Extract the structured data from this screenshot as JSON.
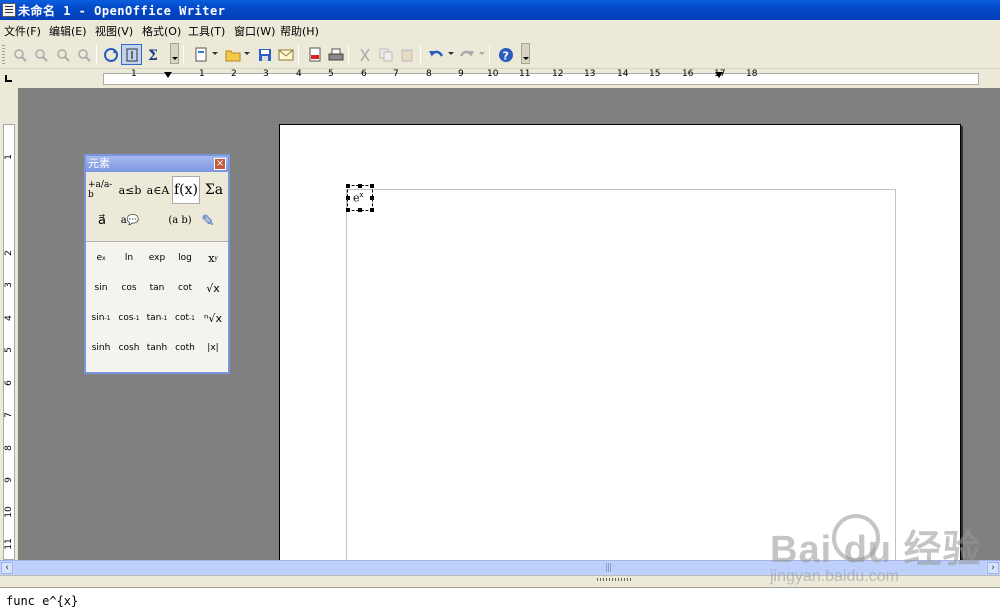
{
  "window": {
    "title": "未命名 1 - OpenOffice Writer"
  },
  "menu": [
    {
      "label": "文件(F)"
    },
    {
      "label": "编辑(E)"
    },
    {
      "label": "视图(V)"
    },
    {
      "label": "格式(O)"
    },
    {
      "label": "工具(T)"
    },
    {
      "label": "窗口(W)"
    },
    {
      "label": "帮助(H)"
    }
  ],
  "ruler": {
    "h_ticks": [
      "1",
      "2",
      "3",
      "4",
      "5",
      "6",
      "7",
      "8",
      "9",
      "10",
      "11",
      "12",
      "13",
      "14",
      "15",
      "16",
      "17",
      "18"
    ],
    "v_ticks": [
      "1",
      "1",
      "2",
      "3",
      "4",
      "5",
      "6",
      "7",
      "8",
      "9",
      "10",
      "11"
    ]
  },
  "elements_panel": {
    "title": "元素",
    "close_glyph": "×",
    "categories": [
      {
        "label": "+a/a-b"
      },
      {
        "label": "a≤b"
      },
      {
        "label": "a∈A"
      },
      {
        "label": "f(x)"
      },
      {
        "label": "Σa"
      },
      {
        "label": "a⃗"
      },
      {
        "label": "a💬"
      },
      {
        "label": "(a b)"
      },
      {
        "label": "✎"
      }
    ],
    "functions": [
      {
        "label": "e",
        "sup": "x"
      },
      {
        "label": "ln",
        "sup": ""
      },
      {
        "label": "exp",
        "sup": ""
      },
      {
        "label": "log",
        "sup": ""
      },
      {
        "label": "x",
        "sup": "y"
      },
      {
        "label": "sin",
        "sup": ""
      },
      {
        "label": "cos",
        "sup": ""
      },
      {
        "label": "tan",
        "sup": ""
      },
      {
        "label": "cot",
        "sup": ""
      },
      {
        "label": "√x",
        "sup": ""
      },
      {
        "label": "sin",
        "sup": "-1"
      },
      {
        "label": "cos",
        "sup": "-1"
      },
      {
        "label": "tan",
        "sup": "-1"
      },
      {
        "label": "cot",
        "sup": "-1"
      },
      {
        "label": "ⁿ√x",
        "sup": ""
      },
      {
        "label": "sinh",
        "sup": ""
      },
      {
        "label": "cosh",
        "sup": ""
      },
      {
        "label": "tanh",
        "sup": ""
      },
      {
        "label": "coth",
        "sup": ""
      },
      {
        "label": "|x|",
        "sup": ""
      }
    ]
  },
  "document": {
    "formula_base": "e",
    "formula_sup": "x"
  },
  "command": {
    "text": "func e^{x}"
  },
  "watermark": {
    "brand": "Bai du 经验",
    "url": "jingyan.baidu.com"
  },
  "colors": {
    "titlebar": "#0348c7",
    "panel_border": "#7a96df",
    "doc_bg": "#808080"
  }
}
